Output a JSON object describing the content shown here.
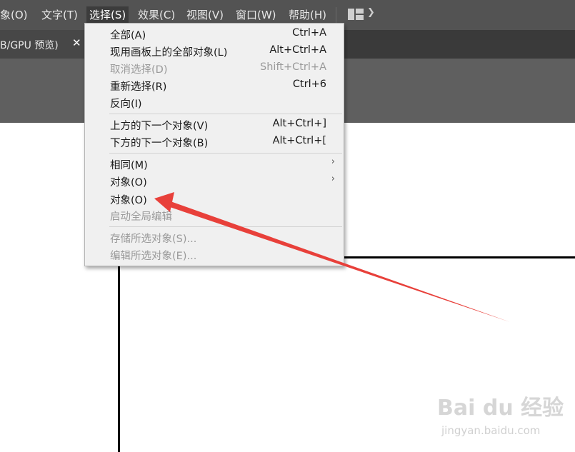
{
  "menubar": {
    "items": [
      {
        "label": "象(O)"
      },
      {
        "label": "文字(T)"
      },
      {
        "label": "选择(S)"
      },
      {
        "label": "效果(C)"
      },
      {
        "label": "视图(V)"
      },
      {
        "label": "窗口(W)"
      },
      {
        "label": "帮助(H)"
      }
    ],
    "workspace_icon": "workspace-layout-icon"
  },
  "document_tab": {
    "label": "B/GPU 预览)",
    "close": "✕"
  },
  "select_menu": {
    "items": [
      {
        "label": "全部(A)",
        "shortcut": "Ctrl+A",
        "enabled": true
      },
      {
        "label": "现用画板上的全部对象(L)",
        "shortcut": "Alt+Ctrl+A",
        "enabled": true
      },
      {
        "label": "取消选择(D)",
        "shortcut": "Shift+Ctrl+A",
        "enabled": false
      },
      {
        "label": "重新选择(R)",
        "shortcut": "Ctrl+6",
        "enabled": true
      },
      {
        "label": "反向(I)",
        "shortcut": "",
        "enabled": true
      },
      {
        "label": "上方的下一个对象(V)",
        "shortcut": "Alt+Ctrl+]",
        "enabled": true
      },
      {
        "label": "下方的下一个对象(B)",
        "shortcut": "Alt+Ctrl+[",
        "enabled": true
      },
      {
        "label": "相同(M)",
        "submenu": true,
        "enabled": true
      },
      {
        "label": "对象(O)",
        "submenu": true,
        "enabled": true
      },
      {
        "label": "对象(O)",
        "enabled": true
      },
      {
        "label": "启动全局编辑",
        "enabled": false
      },
      {
        "label": "存储所选对象(S)...",
        "enabled": false
      },
      {
        "label": "编辑所选对象(E)...",
        "enabled": false
      }
    ],
    "submenu_arrow": "›"
  },
  "annotation": {
    "color": "#e8403a"
  },
  "watermark": {
    "brand": "Bai du 经验",
    "url": "jingyan.baidu.com"
  }
}
